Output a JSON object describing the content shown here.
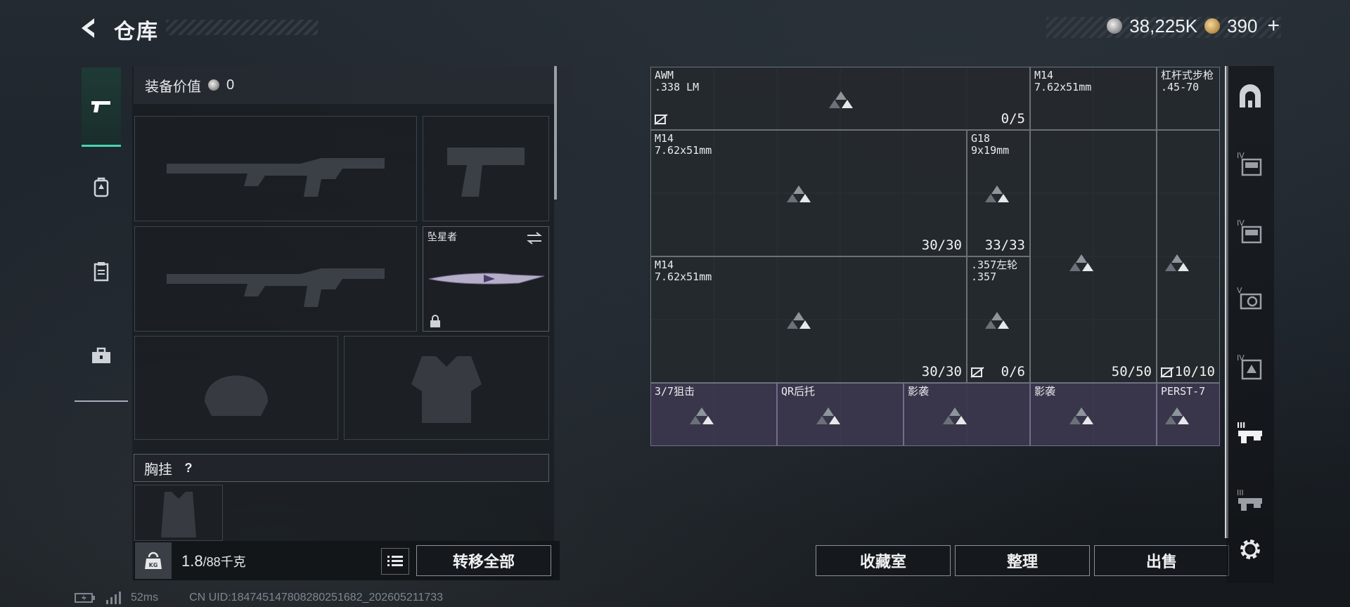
{
  "header": {
    "title": "仓库",
    "silver_amount": "38,225K",
    "gold_amount": "390",
    "gold_plus": "+"
  },
  "left_tabs": [
    {
      "icon": "pistol-icon",
      "active": true
    },
    {
      "icon": "backpack-icon",
      "active": false
    },
    {
      "icon": "clipboard-icon",
      "active": false
    },
    {
      "icon": "toolbox-icon",
      "active": false
    }
  ],
  "equipment": {
    "value_label": "装备价值",
    "value_amount": "0",
    "melee_name": "坠星者",
    "chest_label": "胸挂",
    "help": "?"
  },
  "footer": {
    "weight_current": "1.8",
    "weight_max": "/88千克",
    "kg_label": "KG",
    "transfer_all": "转移全部"
  },
  "grid_items": [
    {
      "name": "AWM",
      "ammo": ".338 LM",
      "count": "0/5"
    },
    {
      "name": "M14",
      "ammo": "7.62x51mm",
      "count": ""
    },
    {
      "name": "杠杆式步枪",
      "ammo": ".45-70",
      "count": ""
    },
    {
      "name": "M14",
      "ammo": "7.62x51mm",
      "count": "30/30"
    },
    {
      "name": "G18",
      "ammo": "9x19mm",
      "count": "33/33"
    },
    {
      "name": "M14",
      "ammo": "7.62x51mm",
      "count": "30/30"
    },
    {
      "name": ".357左轮",
      "ammo": ".357",
      "count": "0/6"
    },
    {
      "name": "",
      "ammo": "",
      "count": "50/50"
    },
    {
      "name": "",
      "ammo": "",
      "count": "10/10"
    },
    {
      "name": "3/7狙击",
      "ammo": "",
      "count": ""
    },
    {
      "name": "QR后托",
      "ammo": "",
      "count": ""
    },
    {
      "name": "影袭",
      "ammo": "",
      "count": ""
    },
    {
      "name": "影袭",
      "ammo": "",
      "count": ""
    },
    {
      "name": "PERST-7",
      "ammo": "",
      "count": ""
    }
  ],
  "actions": {
    "collection": "收藏室",
    "sort": "整理",
    "sell": "出售"
  },
  "right_icons": [
    "lock-room-icon",
    "tier-iv-crate-icon",
    "tier-iv-crate-icon",
    "tier-v-gear-icon",
    "tier-iv-bag-icon",
    "tier-iii-rifle-icon",
    "tier-iii-rifle-icon",
    "gear-icon"
  ],
  "status": {
    "ping": "52ms",
    "uid": "CN UID:184745147808280251682_202605211733"
  }
}
